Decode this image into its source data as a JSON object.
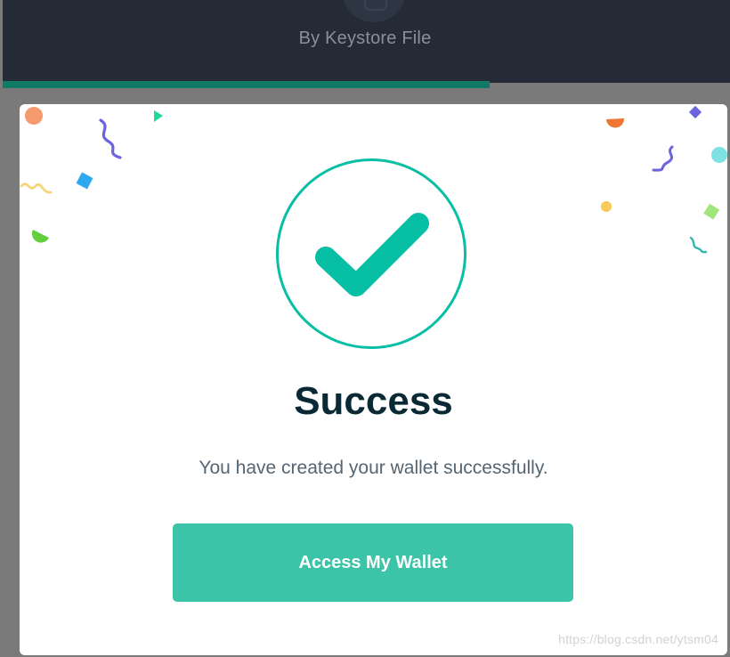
{
  "background": {
    "subtitle": "By Keystore File",
    "header_color": "#252b36",
    "progress_color": "#0f7a66",
    "progress_fraction": 0.67
  },
  "modal": {
    "title": "Success",
    "message": "You have created your wallet successfully.",
    "button_label": "Access My Wallet",
    "accent_color": "#07bfa5",
    "button_color": "#3cc4a8",
    "check_icon": "check-circle-icon",
    "decoration": "confetti"
  },
  "watermark": "https://blog.csdn.net/ytsm04"
}
